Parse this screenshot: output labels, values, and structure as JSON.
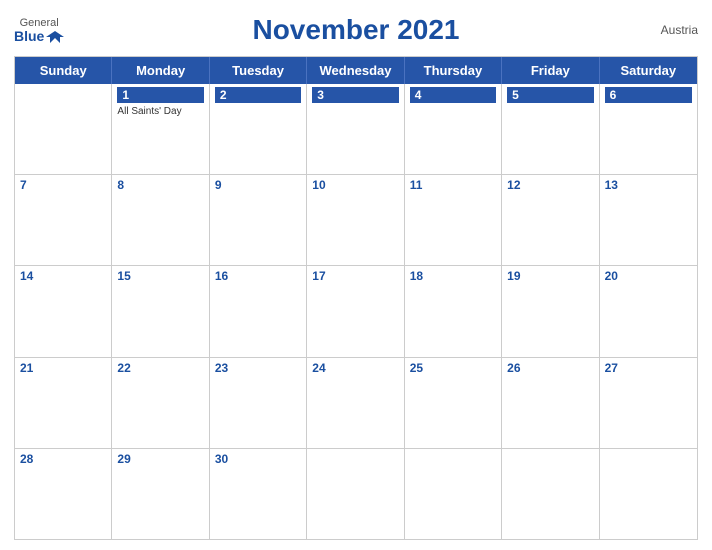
{
  "header": {
    "title": "November 2021",
    "country": "Austria",
    "logo_general": "General",
    "logo_blue": "Blue"
  },
  "days_of_week": [
    "Sunday",
    "Monday",
    "Tuesday",
    "Wednesday",
    "Thursday",
    "Friday",
    "Saturday"
  ],
  "weeks": [
    [
      {
        "day": "",
        "empty": true
      },
      {
        "day": "1",
        "event": "All Saints' Day"
      },
      {
        "day": "2",
        "event": ""
      },
      {
        "day": "3",
        "event": ""
      },
      {
        "day": "4",
        "event": ""
      },
      {
        "day": "5",
        "event": ""
      },
      {
        "day": "6",
        "event": ""
      }
    ],
    [
      {
        "day": "7",
        "event": ""
      },
      {
        "day": "8",
        "event": ""
      },
      {
        "day": "9",
        "event": ""
      },
      {
        "day": "10",
        "event": ""
      },
      {
        "day": "11",
        "event": ""
      },
      {
        "day": "12",
        "event": ""
      },
      {
        "day": "13",
        "event": ""
      }
    ],
    [
      {
        "day": "14",
        "event": ""
      },
      {
        "day": "15",
        "event": ""
      },
      {
        "day": "16",
        "event": ""
      },
      {
        "day": "17",
        "event": ""
      },
      {
        "day": "18",
        "event": ""
      },
      {
        "day": "19",
        "event": ""
      },
      {
        "day": "20",
        "event": ""
      }
    ],
    [
      {
        "day": "21",
        "event": ""
      },
      {
        "day": "22",
        "event": ""
      },
      {
        "day": "23",
        "event": ""
      },
      {
        "day": "24",
        "event": ""
      },
      {
        "day": "25",
        "event": ""
      },
      {
        "day": "26",
        "event": ""
      },
      {
        "day": "27",
        "event": ""
      }
    ],
    [
      {
        "day": "28",
        "event": ""
      },
      {
        "day": "29",
        "event": ""
      },
      {
        "day": "30",
        "event": ""
      },
      {
        "day": "",
        "empty": true
      },
      {
        "day": "",
        "empty": true
      },
      {
        "day": "",
        "empty": true
      },
      {
        "day": "",
        "empty": true
      }
    ]
  ]
}
